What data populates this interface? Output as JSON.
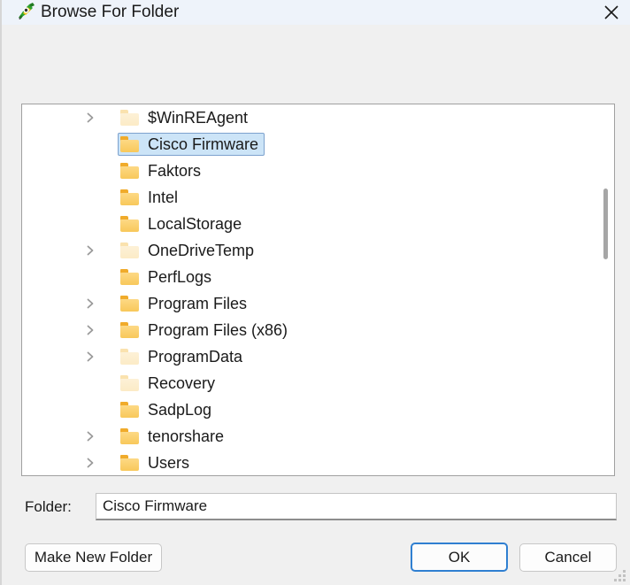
{
  "window": {
    "title": "Browse For Folder",
    "icon": "app-icon",
    "close_icon": "close-icon"
  },
  "tree": {
    "items": [
      {
        "label": "$WinREAgent",
        "expandable": true,
        "pale": true,
        "selected": false
      },
      {
        "label": "Cisco Firmware",
        "expandable": false,
        "pale": false,
        "selected": true
      },
      {
        "label": "Faktors",
        "expandable": false,
        "pale": false,
        "selected": false
      },
      {
        "label": "Intel",
        "expandable": false,
        "pale": false,
        "selected": false
      },
      {
        "label": "LocalStorage",
        "expandable": false,
        "pale": false,
        "selected": false
      },
      {
        "label": "OneDriveTemp",
        "expandable": true,
        "pale": true,
        "selected": false
      },
      {
        "label": "PerfLogs",
        "expandable": false,
        "pale": false,
        "selected": false
      },
      {
        "label": "Program Files",
        "expandable": true,
        "pale": false,
        "selected": false
      },
      {
        "label": "Program Files (x86)",
        "expandable": true,
        "pale": false,
        "selected": false
      },
      {
        "label": "ProgramData",
        "expandable": true,
        "pale": true,
        "selected": false
      },
      {
        "label": "Recovery",
        "expandable": false,
        "pale": true,
        "selected": false
      },
      {
        "label": "SadpLog",
        "expandable": false,
        "pale": false,
        "selected": false
      },
      {
        "label": "tenorshare",
        "expandable": true,
        "pale": false,
        "selected": false
      },
      {
        "label": "Users",
        "expandable": true,
        "pale": false,
        "selected": false
      }
    ],
    "scrollbar": {
      "thumb_top_pct": 22,
      "thumb_height_pct": 19
    }
  },
  "folder_field": {
    "label": "Folder:",
    "value": "Cisco Firmware",
    "placeholder": ""
  },
  "buttons": {
    "make_new_folder": "Make New Folder",
    "ok": "OK",
    "cancel": "Cancel"
  },
  "colors": {
    "titlebar_bg": "#eef3fa",
    "dialog_bg": "#f0f0f0",
    "selection_bg": "#cce4f7",
    "selection_border": "#7da2ce",
    "focus_border": "#2f7fd1",
    "folder_yellow": "#f8c85a",
    "folder_pale": "#fcebc6",
    "text": "#1a1a1a"
  }
}
